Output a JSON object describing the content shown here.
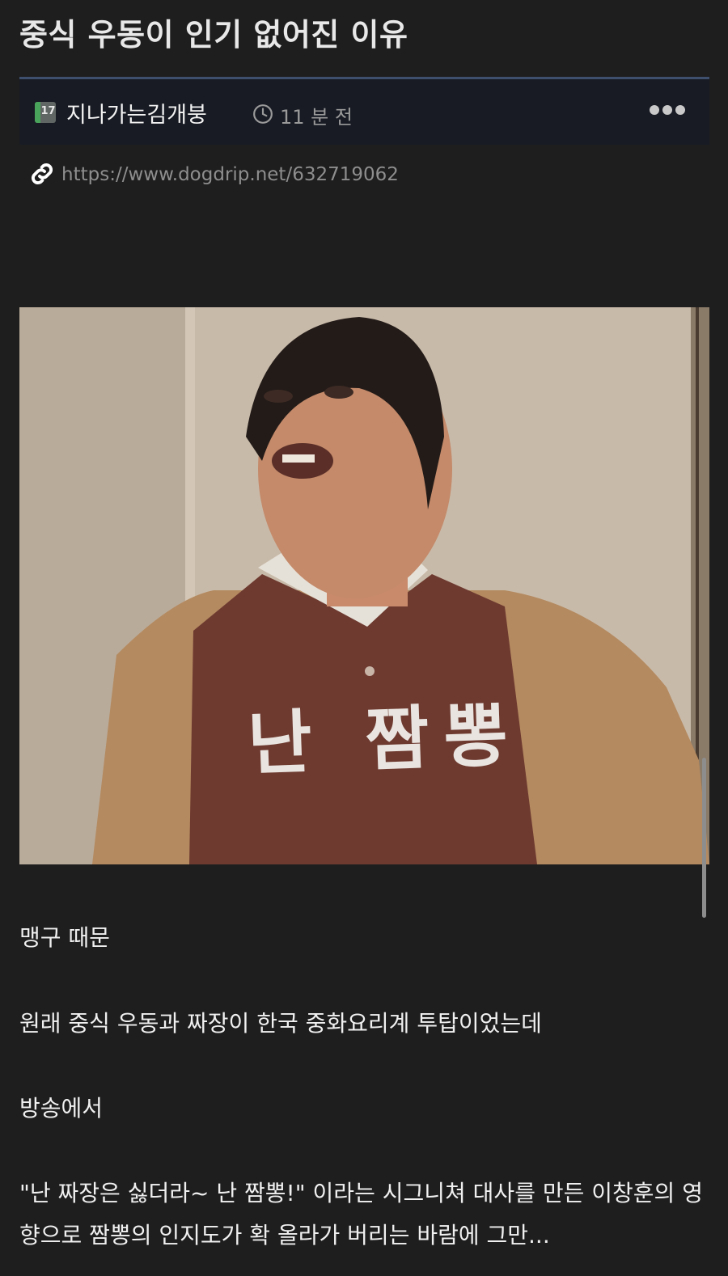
{
  "post": {
    "title": "중식 우동이 인기 없어진 이유",
    "board_icon_text": "17",
    "author": "지나가는김개붕",
    "time": "11 분 전",
    "url": "https://www.dogdrip.net/632719062"
  },
  "image": {
    "caption": "난 짬뽕"
  },
  "content": {
    "paragraphs": [
      "맹구 때문",
      "원래 중식 우동과 짜장이 한국 중화요리계 투탑이었는데",
      "방송에서",
      "\"난 짜장은 싫더라~ 난 짬뽕!\" 이라는 시그니쳐 대사를 만든 이창훈의 영향으로 짬뽕의 인지도가 확 올라가 버리는 바람에 그만..."
    ]
  },
  "colors": {
    "background": "#1e1e1e",
    "meta_bar": "#181b24",
    "meta_border": "#3e4f6d",
    "muted_text": "#8e8e8e"
  },
  "icons": {
    "board": "board-icon",
    "clock": "clock-icon",
    "more": "more-icon",
    "link": "link-icon"
  }
}
